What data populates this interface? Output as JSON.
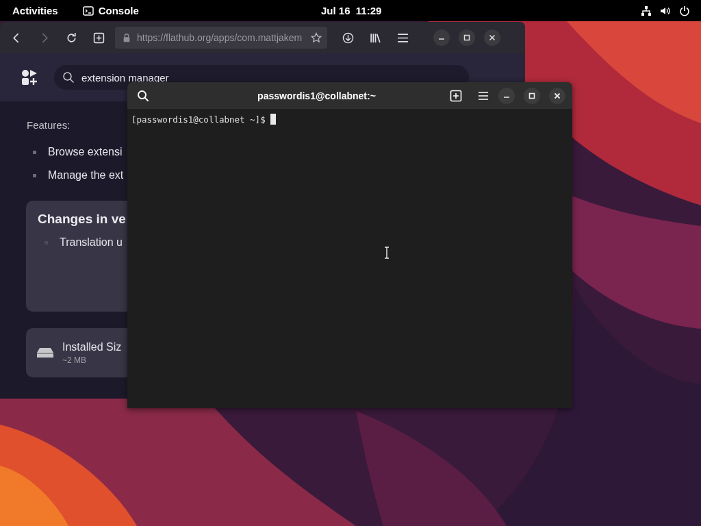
{
  "top_bar": {
    "activities": "Activities",
    "app": "Console",
    "clock": "Jul 16  11:29"
  },
  "browser": {
    "nav": [
      {
        "kind": "back",
        "disabled": false
      },
      {
        "kind": "forward",
        "disabled": true
      }
    ],
    "url": "https://flathub.org/apps/com.mattjakem",
    "search": {
      "value": "extension manager"
    },
    "features_label": "Features:",
    "features": [
      "Browse extensi",
      "Manage the ext"
    ],
    "changes": {
      "title": "Changes in ve",
      "items": [
        "Translation u"
      ]
    },
    "installed": {
      "label": "Installed Siz",
      "value": "~2 MB"
    }
  },
  "terminal": {
    "title": "passwordis1@collabnet:~",
    "prompt": "[passwordis1@collabnet ~]$"
  }
}
